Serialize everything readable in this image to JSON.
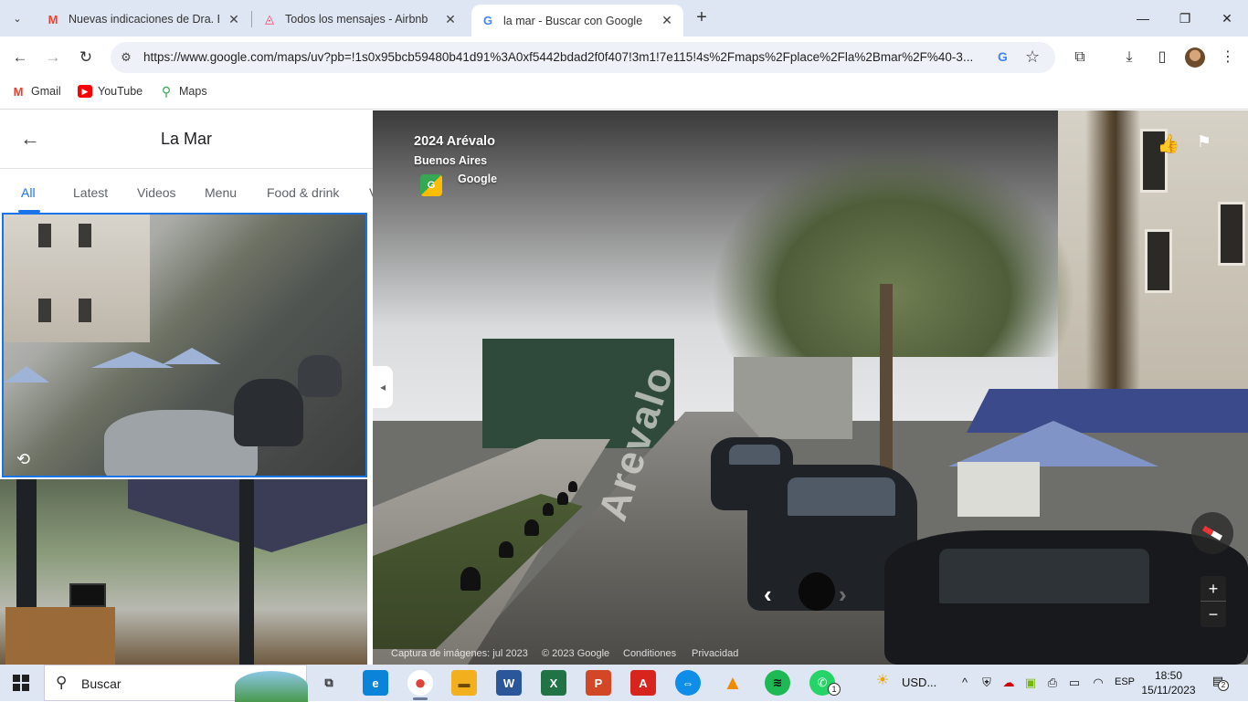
{
  "browser": {
    "tabs": [
      {
        "title": "Nuevas indicaciones de Dra. Be",
        "favicon": "gmail-icon",
        "active": false
      },
      {
        "title": "Todos los mensajes - Airbnb",
        "favicon": "airbnb-icon",
        "active": false
      },
      {
        "title": "la mar - Buscar con Google",
        "favicon": "google-icon",
        "active": true
      }
    ],
    "tab_close_glyph": "✕",
    "new_tab_glyph": "+",
    "window_buttons": {
      "minimize": "—",
      "restore": "❐",
      "close": "✕"
    },
    "url": "https://www.google.com/maps/uv?pb=!1s0x95bcb59480b41d91%3A0xf5442bdad2f0f407!3m1!7e115!4s%2Fmaps%2Fplace%2Fla%2Bmar%2F%40-3...",
    "bookmarks": [
      {
        "label": "Gmail",
        "icon": "gmail-icon",
        "color": "#ea4335"
      },
      {
        "label": "YouTube",
        "icon": "youtube-icon",
        "color": "#ff0000"
      },
      {
        "label": "Maps",
        "icon": "maps-pin-icon",
        "color": "#34a853"
      }
    ]
  },
  "panel": {
    "title": "La Mar",
    "categories": [
      "All",
      "Latest",
      "Videos",
      "Menu",
      "Food & drink",
      "V"
    ],
    "active_category": "All"
  },
  "streetview": {
    "title": "2024 Arévalo",
    "subtitle": "Buenos Aires",
    "provider": "Google",
    "street_label": "Arevalo",
    "footer": {
      "capture": "Captura de imágenes: jul 2023",
      "copyright": "© 2023 Google",
      "terms": "Conditiones",
      "privacy": "Privacidad"
    },
    "zoom_in": "+",
    "zoom_out": "−"
  },
  "taskbar": {
    "search_label": "Buscar",
    "apps": [
      {
        "name": "task-view-icon",
        "glyph": "⧉",
        "color": "#333"
      },
      {
        "name": "edge-icon",
        "glyph": "e",
        "color": "#0a84d8"
      },
      {
        "name": "chrome-icon",
        "glyph": "●",
        "color": "#db4437"
      },
      {
        "name": "file-explorer-icon",
        "glyph": "▬",
        "color": "#f2b01e"
      },
      {
        "name": "word-icon",
        "glyph": "W",
        "color": "#2b579a"
      },
      {
        "name": "excel-icon",
        "glyph": "X",
        "color": "#217346"
      },
      {
        "name": "powerpoint-icon",
        "glyph": "P",
        "color": "#d24726"
      },
      {
        "name": "acrobat-icon",
        "glyph": "A",
        "color": "#d7241c"
      },
      {
        "name": "teamviewer-icon",
        "glyph": "⇔",
        "color": "#0e8ee9"
      },
      {
        "name": "vlc-icon",
        "glyph": "▲",
        "color": "#f08a00"
      },
      {
        "name": "spotify-icon",
        "glyph": "≋",
        "color": "#1db954"
      },
      {
        "name": "whatsapp-icon",
        "glyph": "✆",
        "color": "#25d366"
      }
    ],
    "whatsapp_badge": "1",
    "weather": "USD...",
    "language": "ESP",
    "time": "18:50",
    "date": "15/11/2023",
    "notifications": "2"
  }
}
